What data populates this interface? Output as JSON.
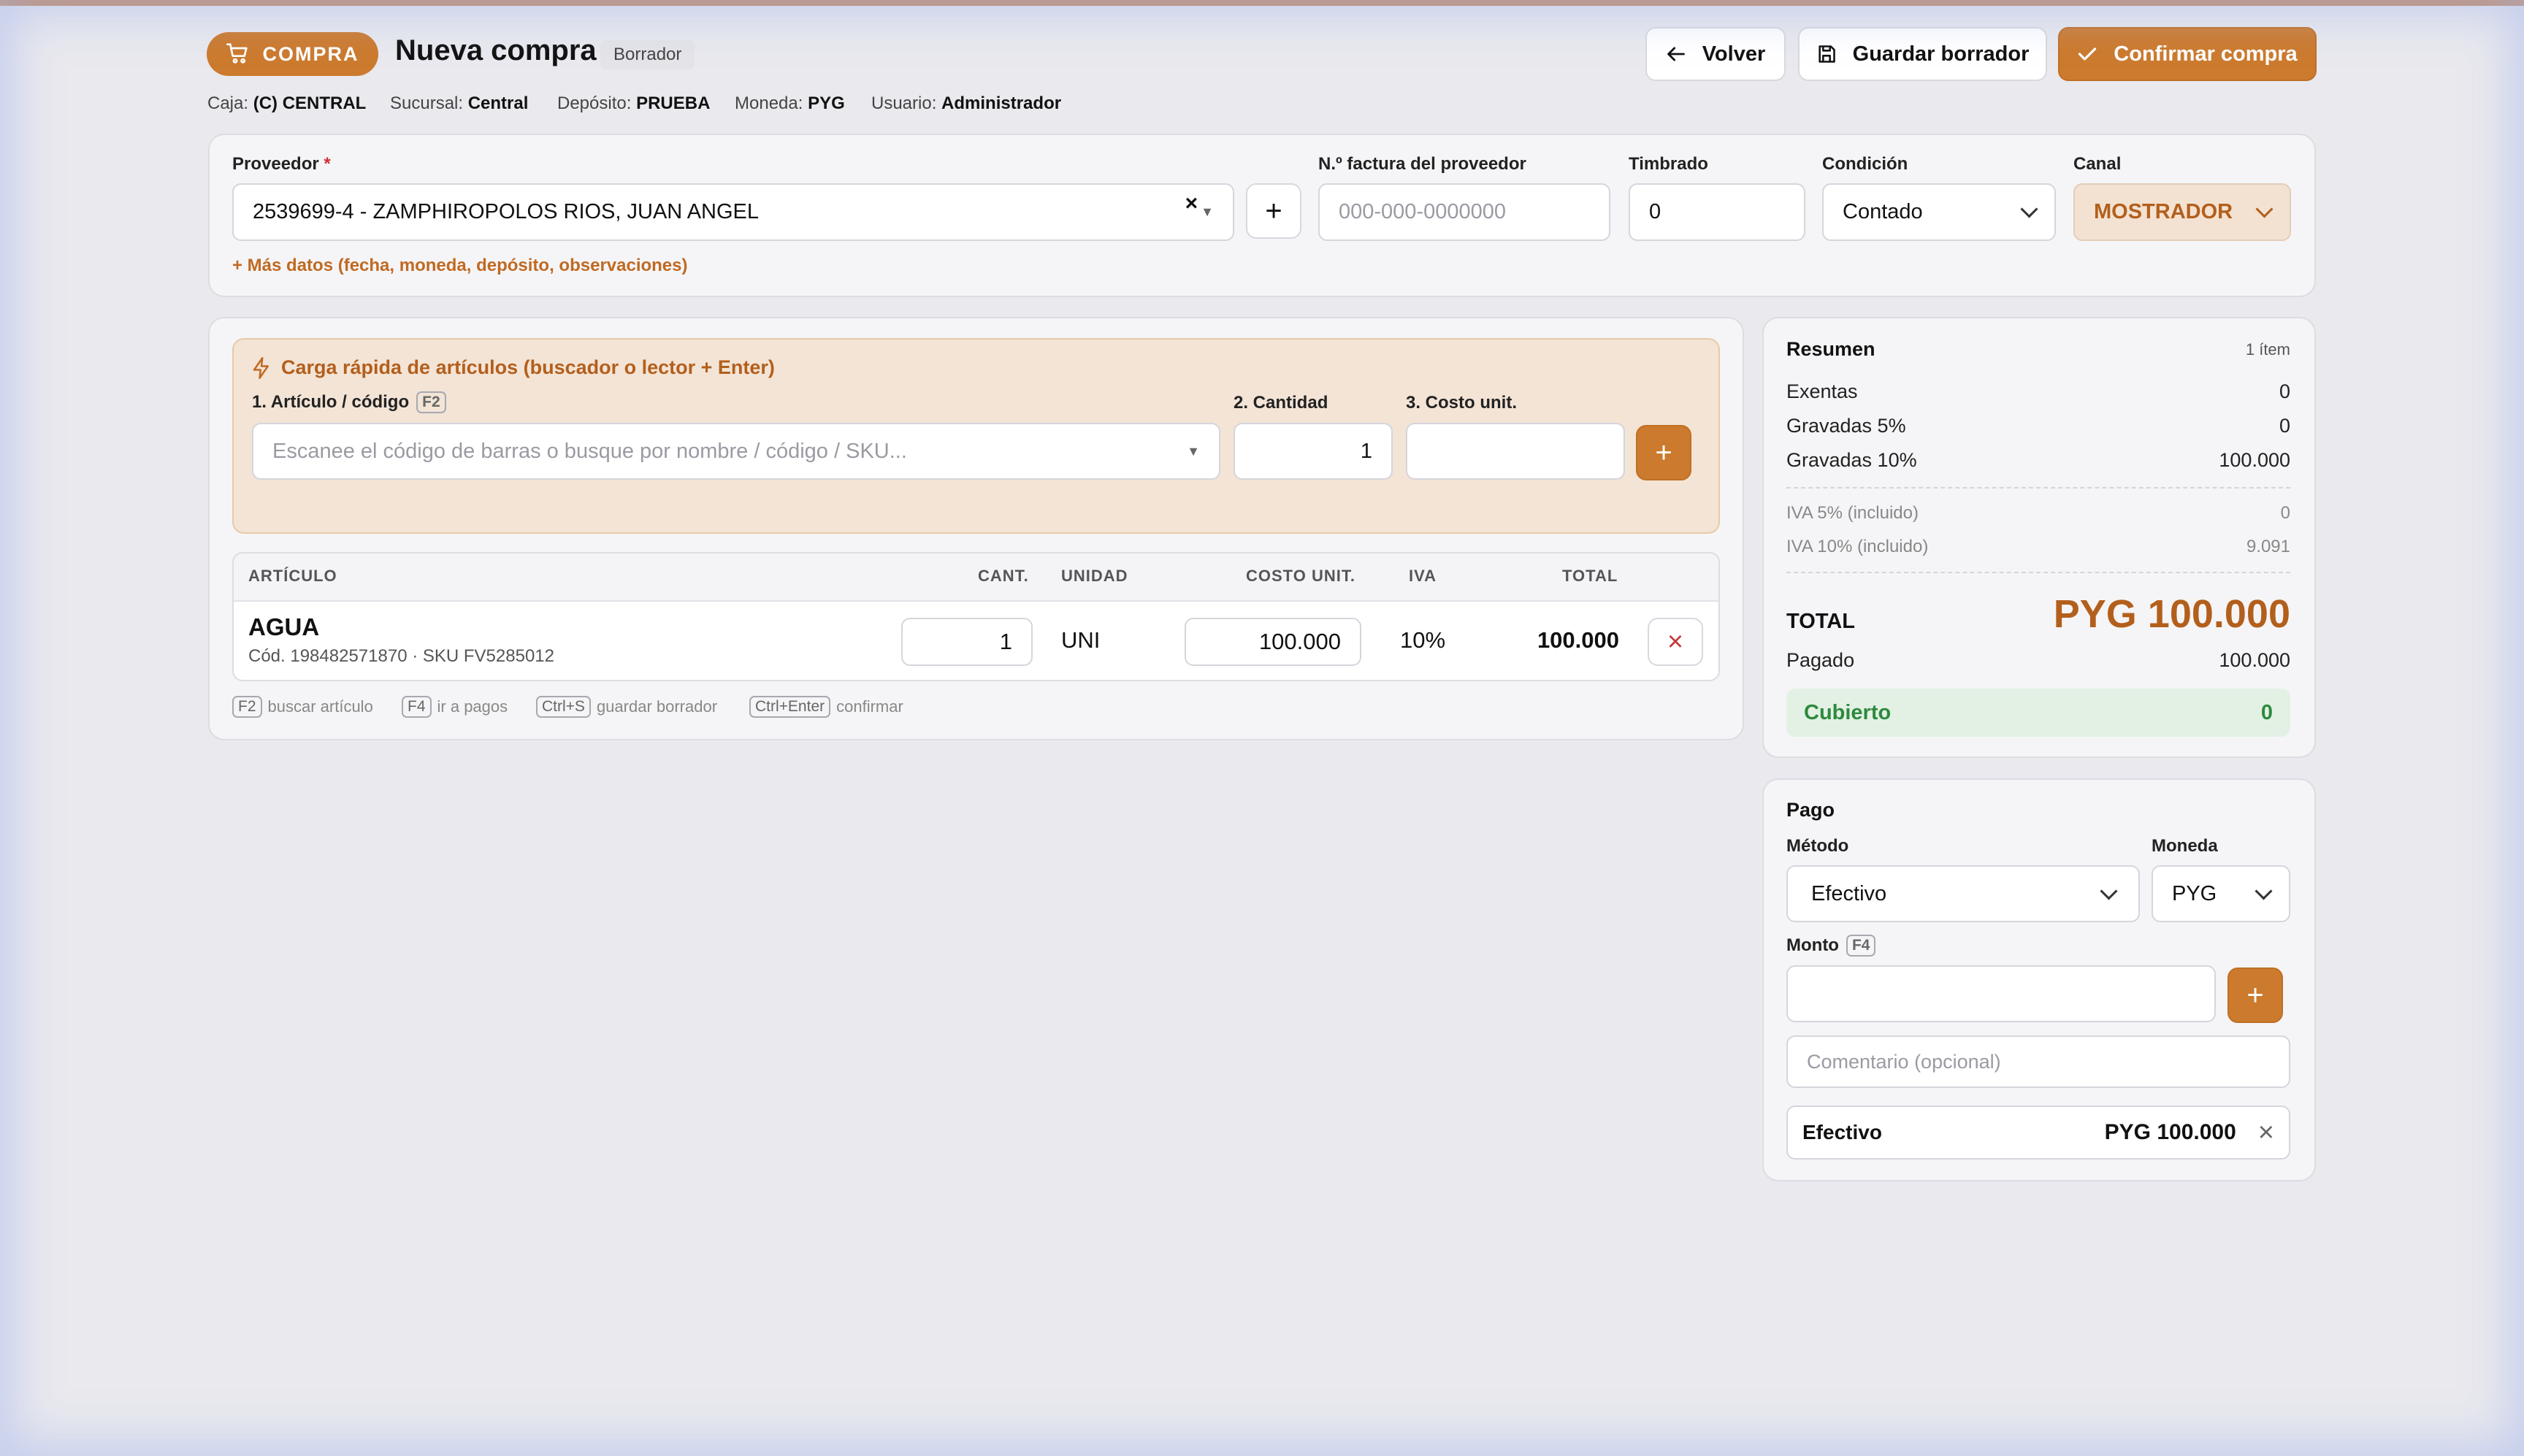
{
  "header": {
    "badge": "COMPRA",
    "title": "Nueva compra",
    "status": "Borrador",
    "buttons": {
      "back": "Volver",
      "save_draft": "Guardar borrador",
      "confirm": "Confirmar compra"
    }
  },
  "context": [
    {
      "label": "Caja:",
      "value": "(C) CENTRAL"
    },
    {
      "label": "Sucursal:",
      "value": "Central"
    },
    {
      "label": "Depósito:",
      "value": "PRUEBA"
    },
    {
      "label": "Moneda:",
      "value": "PYG"
    },
    {
      "label": "Usuario:",
      "value": "Administrador"
    }
  ],
  "supplier_form": {
    "supplier_label": "Proveedor",
    "required_mark": "*",
    "supplier_value": "2539699-4 - ZAMPHIROPOLOS RIOS, JUAN ANGEL",
    "invoice_label": "N.º factura del proveedor",
    "invoice_placeholder": "000-000-0000000",
    "timbrado_label": "Timbrado",
    "timbrado_value": "0",
    "condition_label": "Condición",
    "condition_value": "Contado",
    "channel_label": "Canal",
    "channel_value": "MOSTRADOR",
    "more_data": "+ Más datos (fecha, moneda, depósito, observaciones)"
  },
  "quick_load": {
    "title": "Carga rápida de artículos (buscador o lector + Enter)",
    "article_label": "1. Artículo / código",
    "article_key": "F2",
    "article_placeholder": "Escanee el código de barras o busque por nombre / código / SKU...",
    "quantity_label": "2. Cantidad",
    "quantity_value": "1",
    "cost_label": "3. Costo unit."
  },
  "items_table": {
    "headers": {
      "article": "ARTÍCULO",
      "qty": "CANT.",
      "unit": "UNIDAD",
      "cost": "COSTO UNIT.",
      "iva": "IVA",
      "total": "TOTAL"
    },
    "rows": [
      {
        "name": "AGUA",
        "sub": "Cód. 198482571870 · SKU FV5285012",
        "qty": "1",
        "unit": "UNI",
        "cost": "100.000",
        "iva": "10%",
        "total": "100.000"
      }
    ]
  },
  "shortcuts": [
    {
      "key": "F2",
      "text": "buscar artículo"
    },
    {
      "key": "F4",
      "text": "ir a pagos"
    },
    {
      "key": "Ctrl+S",
      "text": "guardar borrador"
    },
    {
      "key": "Ctrl+Enter",
      "text": "confirmar"
    }
  ],
  "summary": {
    "title": "Resumen",
    "items_count": "1 ítem",
    "rows": [
      {
        "label": "Exentas",
        "value": "0"
      },
      {
        "label": "Gravadas 5%",
        "value": "0"
      },
      {
        "label": "Gravadas 10%",
        "value": "100.000"
      }
    ],
    "iva_rows": [
      {
        "label": "IVA 5% (incluido)",
        "value": "0"
      },
      {
        "label": "IVA 10% (incluido)",
        "value": "9.091"
      }
    ],
    "total_label": "TOTAL",
    "total_value": "PYG 100.000",
    "paid_label": "Pagado",
    "paid_value": "100.000",
    "covered_label": "Cubierto",
    "covered_value": "0"
  },
  "payment": {
    "title": "Pago",
    "method_label": "Método",
    "method_value": "Efectivo",
    "currency_label": "Moneda",
    "currency_value": "PYG",
    "amount_label": "Monto",
    "amount_key": "F4",
    "comment_placeholder": "Comentario (opcional)",
    "entry": {
      "method": "Efectivo",
      "amount": "PYG 100.000"
    }
  },
  "colors": {
    "accent": "#cc7a2d",
    "accent_text": "#b35f1c",
    "covered_bg": "#e3f1e4",
    "covered_text": "#2d8a3e",
    "danger": "#c33a3a"
  }
}
